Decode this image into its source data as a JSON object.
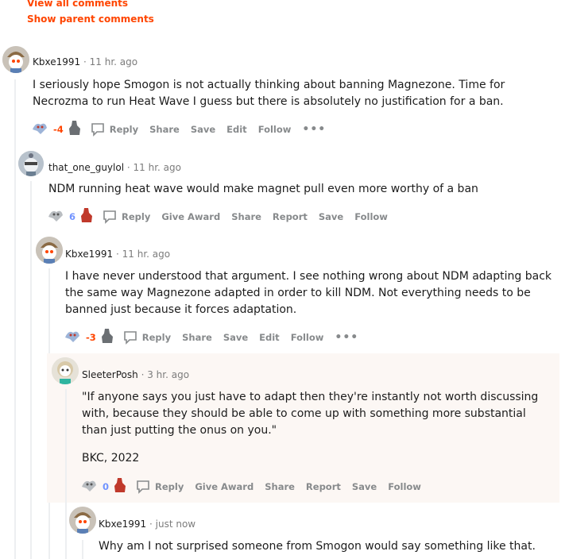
{
  "links": {
    "view_all": "View all comments",
    "show_parent": "Show parent comments"
  },
  "comments": [
    {
      "user": "Kbxe1991",
      "dot": "·",
      "time": "11 hr. ago",
      "body": [
        "I seriously hope Smogon is not actually thinking about banning Magnezone. Time for Necrozma to run Heat Wave I guess but there is absolutely no justification for a ban."
      ],
      "score": "-4",
      "actions": {
        "reply": "Reply",
        "share": "Share",
        "save": "Save",
        "edit": "Edit",
        "follow": "Follow"
      }
    },
    {
      "user": "that_one_guylol",
      "dot": "·",
      "time": "11 hr. ago",
      "body": [
        "NDM running heat wave would make magnet pull even more worthy of a ban"
      ],
      "score": "6",
      "actions": {
        "reply": "Reply",
        "award": "Give Award",
        "share": "Share",
        "report": "Report",
        "save": "Save",
        "follow": "Follow"
      }
    },
    {
      "user": "Kbxe1991",
      "dot": "·",
      "time": "11 hr. ago",
      "body": [
        "I have never understood that argument. I see nothing wrong about NDM adapting back the same way Magnezone adapted in order to kill NDM. Not everything needs to be banned just because it forces adaptation."
      ],
      "score": "-3",
      "actions": {
        "reply": "Reply",
        "share": "Share",
        "save": "Save",
        "edit": "Edit",
        "follow": "Follow"
      }
    },
    {
      "user": "SleeterPosh",
      "dot": "·",
      "time": "3 hr. ago",
      "body": [
        "\"If anyone says you just have to adapt then they're instantly not worth discussing with, because they should be able to come up with something more substantial than just putting the onus on you.\"",
        "BKC, 2022"
      ],
      "score": "0",
      "actions": {
        "reply": "Reply",
        "award": "Give Award",
        "share": "Share",
        "report": "Report",
        "save": "Save",
        "follow": "Follow"
      }
    },
    {
      "user": "Kbxe1991",
      "dot": "·",
      "time": "just now",
      "body": [
        "Why am I not surprised someone from Smogon would say something like that."
      ]
    }
  ],
  "icons": {
    "upvote": "upvote-icon",
    "downvote": "downvote-icon",
    "reply": "speech-bubble-icon",
    "more": "more-options-icon"
  },
  "colors": {
    "accent": "#ff4500",
    "upvote": "#7193ff",
    "muted": "#878a8c",
    "highlight": "#fcf7f4"
  }
}
